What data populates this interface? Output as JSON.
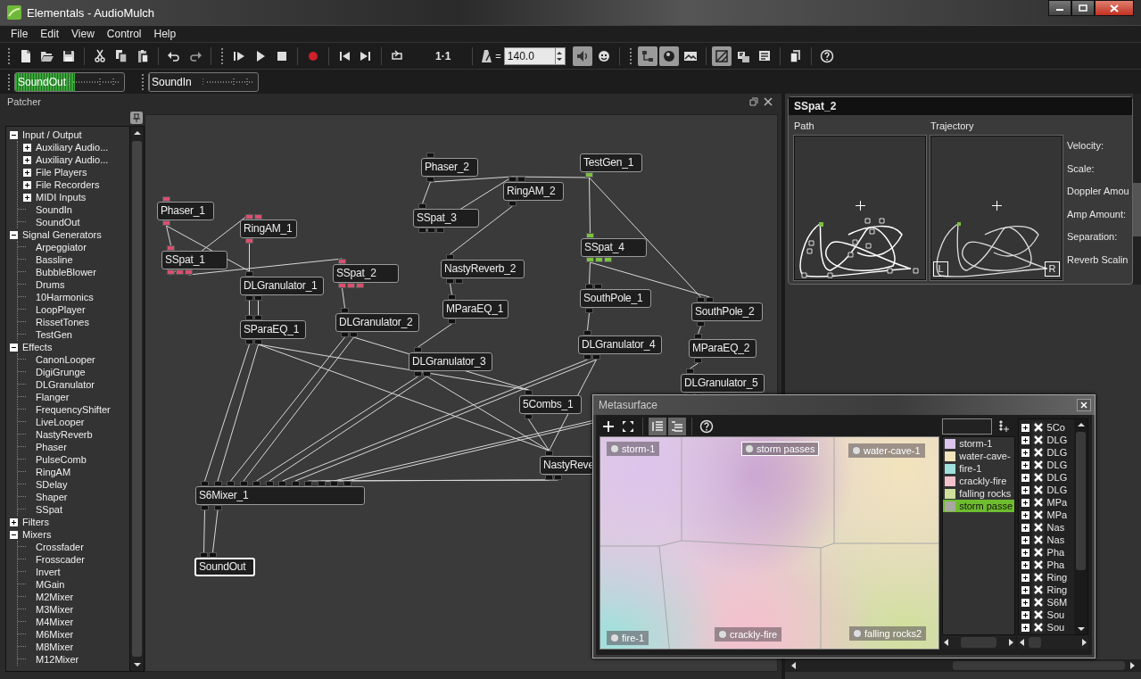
{
  "window": {
    "title": "Elementals - AudioMulch"
  },
  "menu": [
    "File",
    "Edit",
    "View",
    "Control",
    "Help"
  ],
  "toolbar": {
    "buttons": [
      {
        "pressed": false
      },
      {
        "pressed": false
      },
      {
        "pressed": false
      },
      {
        "pressed": false
      },
      {
        "pressed": false
      },
      {
        "pressed": false
      },
      {
        "pressed": false
      },
      {
        "pressed": false
      },
      {
        "pressed": false
      },
      {
        "pressed": false
      },
      {
        "pressed": false
      },
      {
        "pressed": false
      },
      {
        "pressed": false
      },
      {
        "pressed": false
      },
      {
        "pressed": false
      },
      {
        "pressed": true
      },
      {
        "pressed": false
      },
      {
        "pressed": true
      },
      {
        "pressed": true
      },
      {
        "pressed": false
      },
      {
        "pressed": true
      },
      {
        "pressed": false
      },
      {
        "pressed": false
      },
      {
        "pressed": false
      },
      {
        "pressed": false
      }
    ],
    "position": "1·1",
    "tempo_label": "=",
    "tempo": "140.0"
  },
  "meters": [
    {
      "label": "SoundOut",
      "level": 0.55
    },
    {
      "label": "SoundIn",
      "level": 0
    }
  ],
  "patcher": {
    "title": "Patcher",
    "tree": [
      {
        "label": "Input / Output",
        "expanded": true,
        "children": [
          {
            "label": "Auxiliary Audio...",
            "expanded": false
          },
          {
            "label": "Auxiliary Audio...",
            "expanded": false
          },
          {
            "label": "File Players",
            "expanded": false
          },
          {
            "label": "File Recorders",
            "expanded": false
          },
          {
            "label": "MIDI Inputs",
            "expanded": false
          },
          {
            "label": "SoundIn"
          },
          {
            "label": "SoundOut"
          }
        ]
      },
      {
        "label": "Signal Generators",
        "expanded": true,
        "children": [
          {
            "label": "Arpeggiator"
          },
          {
            "label": "Bassline"
          },
          {
            "label": "BubbleBlower"
          },
          {
            "label": "Drums"
          },
          {
            "label": "10Harmonics"
          },
          {
            "label": "LoopPlayer"
          },
          {
            "label": "RissetTones"
          },
          {
            "label": "TestGen"
          }
        ]
      },
      {
        "label": "Effects",
        "expanded": true,
        "children": [
          {
            "label": "CanonLooper"
          },
          {
            "label": "DigiGrunge"
          },
          {
            "label": "DLGranulator"
          },
          {
            "label": "Flanger"
          },
          {
            "label": "FrequencyShifter"
          },
          {
            "label": "LiveLooper"
          },
          {
            "label": "NastyReverb"
          },
          {
            "label": "Phaser"
          },
          {
            "label": "PulseComb"
          },
          {
            "label": "RingAM"
          },
          {
            "label": "SDelay"
          },
          {
            "label": "Shaper"
          },
          {
            "label": "SSpat"
          }
        ]
      },
      {
        "label": "Filters",
        "expanded": false
      },
      {
        "label": "Mixers",
        "expanded": true,
        "children": [
          {
            "label": "Crossfader"
          },
          {
            "label": "Frosscader"
          },
          {
            "label": "Invert"
          },
          {
            "label": "MGain"
          },
          {
            "label": "M2Mixer"
          },
          {
            "label": "M3Mixer"
          },
          {
            "label": "M4Mixer"
          },
          {
            "label": "M6Mixer"
          },
          {
            "label": "M8Mixer"
          },
          {
            "label": "M12Mixer"
          }
        ]
      }
    ],
    "nodes": [
      {
        "label": "Phaser_1",
        "color": "#d9506e",
        "selected": false
      },
      {
        "label": "RingAM_1",
        "color": "#d9506e",
        "selected": false
      },
      {
        "label": "SSpat_1",
        "color": "#d9506e",
        "selected": false
      },
      {
        "label": "SSpat_2",
        "color": "#d9506e",
        "selected": false
      },
      {
        "label": "DLGranulator_1",
        "color": "#111111",
        "selected": false
      },
      {
        "label": "SParaEQ_1",
        "color": "#111111",
        "selected": false
      },
      {
        "label": "DLGranulator_2",
        "color": "#111111",
        "selected": false
      },
      {
        "label": "Phaser_2",
        "color": "#111111",
        "selected": false
      },
      {
        "label": "RingAM_2",
        "color": "#111111",
        "selected": false
      },
      {
        "label": "SSpat_3",
        "color": "#111111",
        "selected": false
      },
      {
        "label": "TestGen_1",
        "color": "#7cc142",
        "selected": false
      },
      {
        "label": "SSpat_4",
        "color": "#7cc142",
        "selected": false
      },
      {
        "label": "NastyReverb_2",
        "color": "#111111",
        "selected": false
      },
      {
        "label": "MParaEQ_1",
        "color": "#111111",
        "selected": false
      },
      {
        "label": "SouthPole_1",
        "color": "#111111",
        "selected": false
      },
      {
        "label": "SouthPole_2",
        "color": "#111111",
        "selected": false
      },
      {
        "label": "DLGranulator_4",
        "color": "#111111",
        "selected": false
      },
      {
        "label": "MParaEQ_2",
        "color": "#111111",
        "selected": false
      },
      {
        "label": "DLGranulator_3",
        "color": "#111111",
        "selected": false
      },
      {
        "label": "DLGranulator_5",
        "color": "#111111",
        "selected": false
      },
      {
        "label": "5Combs_1",
        "color": "#111111",
        "selected": false
      },
      {
        "label": "NastyReve",
        "color": "#111111",
        "selected": false
      },
      {
        "label": "S6Mixer_1",
        "color": "#111111",
        "selected": false
      },
      {
        "label": "SoundOut",
        "color": "#111111",
        "selected": true
      }
    ]
  },
  "inspector": {
    "title": "SSpat_2",
    "path_label": "Path",
    "trajectory_label": "Trajectory",
    "speakers": [
      "L",
      "R"
    ],
    "parameters": [
      "Velocity:",
      "Scale:",
      "Doppler Amou",
      "Amp Amount:",
      "Separation:",
      "Reverb Scalin"
    ]
  },
  "metasurface": {
    "title": "Metasurface",
    "markers": [
      {
        "label": "storm-1",
        "selected": false
      },
      {
        "label": "storm passes",
        "selected": true
      },
      {
        "label": "water-cave-1",
        "selected": false
      },
      {
        "label": "fire-1",
        "selected": false
      },
      {
        "label": "crackly-fire",
        "selected": false
      },
      {
        "label": "falling rocks2",
        "selected": false
      }
    ],
    "presets": [
      {
        "label": "storm-1",
        "color": "#dcc4ec",
        "selected": false
      },
      {
        "label": "water-cave-",
        "color": "#f2e4bc",
        "selected": false
      },
      {
        "label": "fire-1",
        "color": "#9fe0dc",
        "selected": false
      },
      {
        "label": "crackly-fire",
        "color": "#f4c0cc",
        "selected": false
      },
      {
        "label": "falling rocks",
        "color": "#d0e09c",
        "selected": false
      },
      {
        "label": "storm passe",
        "color": "#a8a8a0",
        "selected": true
      }
    ],
    "objects": [
      {
        "label": "5Co",
        "expanded": false
      },
      {
        "label": "DLG",
        "expanded": false
      },
      {
        "label": "DLG",
        "expanded": false
      },
      {
        "label": "DLG",
        "expanded": false
      },
      {
        "label": "DLG",
        "expanded": false
      },
      {
        "label": "DLG",
        "expanded": false
      },
      {
        "label": "MPa",
        "expanded": false
      },
      {
        "label": "MPa",
        "expanded": false
      },
      {
        "label": "Nas",
        "expanded": false
      },
      {
        "label": "Nas",
        "expanded": false
      },
      {
        "label": "Pha",
        "expanded": false
      },
      {
        "label": "Pha",
        "expanded": false
      },
      {
        "label": "Ring",
        "expanded": false
      },
      {
        "label": "Ring",
        "expanded": false
      },
      {
        "label": "S6M",
        "expanded": false
      },
      {
        "label": "Sou",
        "expanded": false
      },
      {
        "label": "Sou",
        "expanded": false
      }
    ]
  }
}
